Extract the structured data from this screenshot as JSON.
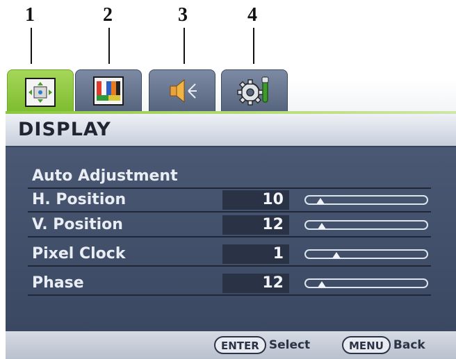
{
  "callouts": [
    "1",
    "2",
    "3",
    "4"
  ],
  "tabs": [
    {
      "name": "Display",
      "icon": "display-adjust-icon",
      "active": true
    },
    {
      "name": "Picture",
      "icon": "color-bars-icon",
      "active": false
    },
    {
      "name": "Audio",
      "icon": "speaker-icon",
      "active": false
    },
    {
      "name": "System",
      "icon": "gear-wrench-icon",
      "active": false
    }
  ],
  "header": {
    "title": "DISPLAY"
  },
  "menu": {
    "items": [
      {
        "label": "Auto Adjustment",
        "value": null,
        "slider": null
      },
      {
        "label": "H. Position",
        "value": "10",
        "slider": 0.12
      },
      {
        "label": "V. Position",
        "value": "12",
        "slider": 0.13
      },
      {
        "label": "Pixel Clock",
        "value": "1",
        "slider": 0.25
      },
      {
        "label": "Phase",
        "value": "12",
        "slider": 0.13
      }
    ]
  },
  "footer": {
    "enter_key": "ENTER",
    "enter_action": "Select",
    "menu_key": "MENU",
    "menu_action": "Back"
  },
  "colors": {
    "active_tab": "#8cc63f",
    "panel": "#44526c",
    "header": "#dfe4ec"
  }
}
